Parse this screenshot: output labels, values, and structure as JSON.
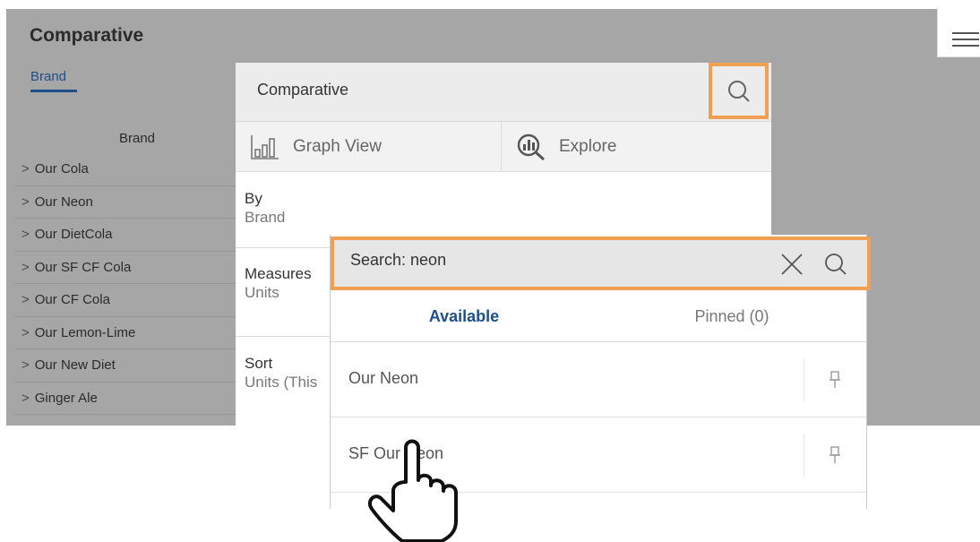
{
  "background": {
    "title": "Comparative",
    "tab_label": "Brand",
    "column_header": "Brand",
    "brands": [
      {
        "label": "Our Cola"
      },
      {
        "label": "Our Neon"
      },
      {
        "label": "Our DietCola"
      },
      {
        "label": "Our SF CF Cola"
      },
      {
        "label": "Our CF Cola"
      },
      {
        "label": "Our Lemon-Lime"
      },
      {
        "label": "Our New Diet"
      },
      {
        "label": "Ginger Ale"
      }
    ]
  },
  "panel": {
    "title": "Comparative",
    "graph_view_label": "Graph View",
    "explore_label": "Explore",
    "by_label": "By",
    "by_value": "Brand",
    "measures_label": "Measures",
    "measures_value": "Units",
    "sort_label": "Sort",
    "sort_value": "Units (This"
  },
  "search": {
    "query_text": "Search: neon",
    "tab_available": "Available",
    "tab_pinned": "Pinned (0)",
    "results": [
      {
        "name": "Our Neon"
      },
      {
        "name": "SF Our Neon"
      }
    ]
  },
  "colors": {
    "highlight": "#f0a050",
    "accent": "#1f4e8c",
    "overlay": "#a6a6a6"
  }
}
